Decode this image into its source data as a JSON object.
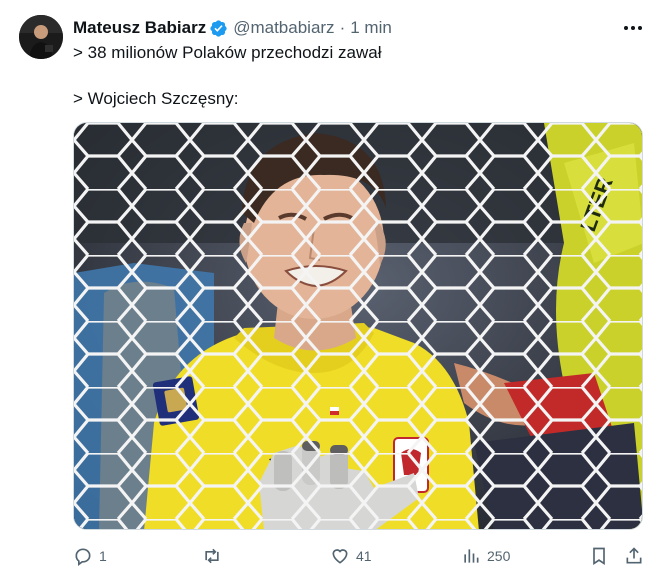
{
  "author": {
    "name": "Mateusz Babiarz",
    "handle": "@matbabiarz",
    "separator": "·",
    "time": "1 min"
  },
  "post": {
    "line1": "> 38 milionów Polaków przechodzi zawał",
    "line2": "> Wojciech Szczęsny:"
  },
  "actions": {
    "replies": "1",
    "reposts": "",
    "likes": "41",
    "views": "250"
  },
  "colors": {
    "verified_blue": "#1d9bf0",
    "secondary_text": "#536471",
    "jersey_yellow": "#f2e22a"
  },
  "icons": [
    "verified-badge-icon",
    "more-icon",
    "reply-icon",
    "repost-icon",
    "like-icon",
    "views-icon",
    "bookmark-icon",
    "share-icon"
  ]
}
